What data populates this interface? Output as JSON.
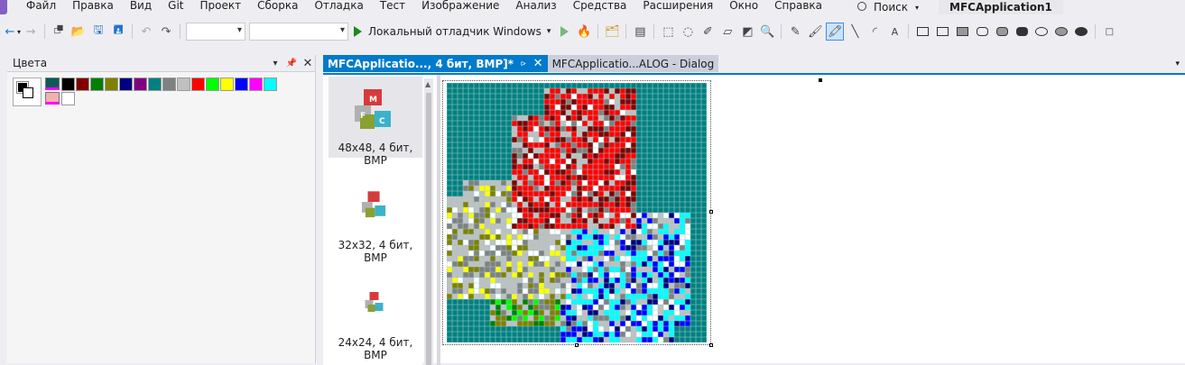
{
  "menu": {
    "items": [
      "Файл",
      "Правка",
      "Вид",
      "Git",
      "Проект",
      "Сборка",
      "Отладка",
      "Тест",
      "Изображение",
      "Анализ",
      "Средства",
      "Расширения",
      "Окно",
      "Справка"
    ],
    "search_label": "Поиск",
    "app_title": "MFCApplication1"
  },
  "toolbar": {
    "debugger_label": "Локальный отладчик Windows",
    "config_combo_value": "",
    "platform_combo_value": ""
  },
  "colors_panel": {
    "title": "Цвета",
    "foreground": "#000000",
    "background": "#ffffff",
    "palette": [
      "#000000",
      "#800000",
      "#008000",
      "#808000",
      "#000080",
      "#800080",
      "#008080",
      "#808080",
      "#c0c0c0",
      "#ff0000",
      "#00ff00",
      "#ffff00",
      "#0000ff",
      "#ff00ff",
      "#00ffff"
    ],
    "palette_row2": [
      "#ffffff"
    ]
  },
  "tabs": [
    {
      "label": "MFCApplicatio..., 4 бит, BMP]*",
      "active": true
    },
    {
      "label": "MFCApplicatio...ALOG - Dialog",
      "active": false
    }
  ],
  "thumbnails": [
    {
      "label": "48x48, 4 бит, BMP",
      "selected": true
    },
    {
      "label": "32x32, 4 бит, BMP",
      "selected": false
    },
    {
      "label": "24x24, 4 бит, BMP",
      "selected": false
    }
  ],
  "canvas": {
    "background_color": "#008080",
    "grid_size": 48
  }
}
